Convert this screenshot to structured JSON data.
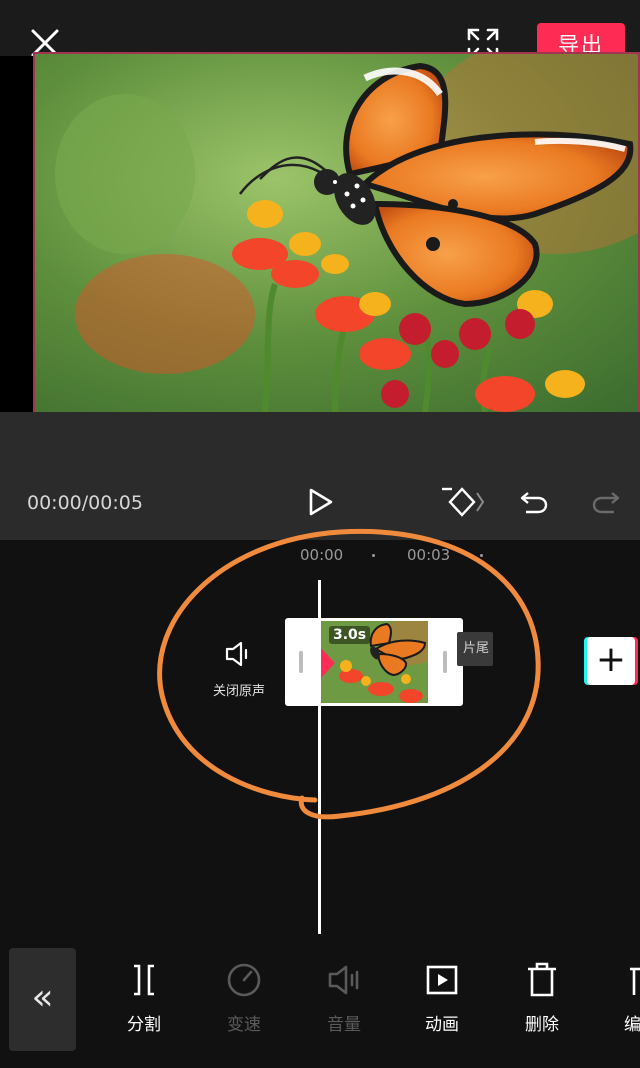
{
  "header": {
    "export_label": "导出",
    "close_icon": "close-icon",
    "fullscreen_icon": "fullscreen-icon"
  },
  "player": {
    "time_readout": "00:00/00:05",
    "play_icon": "play-icon",
    "keyframe_icon": "keyframe-icon",
    "undo_icon": "undo-icon",
    "redo_icon": "redo-icon"
  },
  "timeline": {
    "ruler": [
      "00:00",
      "00:03"
    ],
    "mute_label": "关闭原声",
    "clip_duration": "3.0s",
    "outro_label": "片尾",
    "add_label": "+"
  },
  "toolbar": {
    "collapse_label": "«",
    "tools": [
      {
        "label": "分割",
        "icon": "split-icon",
        "enabled": true
      },
      {
        "label": "变速",
        "icon": "speed-icon",
        "enabled": false
      },
      {
        "label": "音量",
        "icon": "volume-icon",
        "enabled": false
      },
      {
        "label": "动画",
        "icon": "animation-icon",
        "enabled": true
      },
      {
        "label": "删除",
        "icon": "delete-icon",
        "enabled": true
      },
      {
        "label": "编",
        "icon": "edit-icon",
        "enabled": true
      }
    ]
  },
  "colors": {
    "accent": "#fe2c55",
    "annotation": "#f08a3c",
    "background": "#111111"
  }
}
